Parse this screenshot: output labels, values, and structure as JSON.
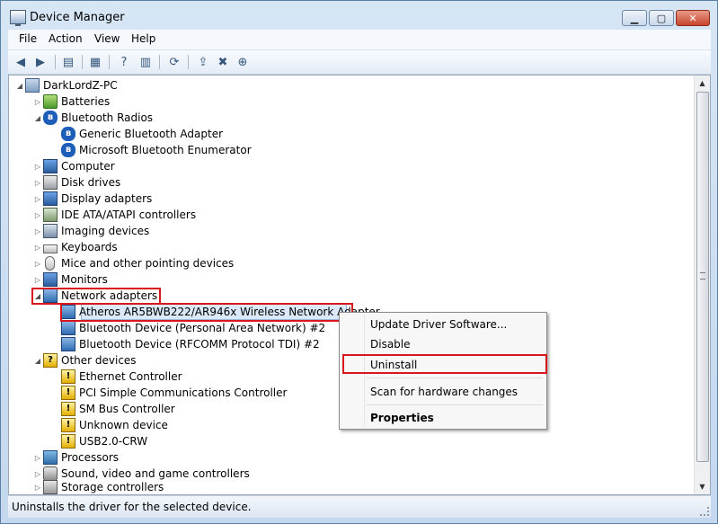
{
  "window": {
    "title": "Device Manager",
    "caption_min": "▁",
    "caption_max": "▢",
    "caption_close": "✕"
  },
  "menu": [
    "File",
    "Action",
    "View",
    "Help"
  ],
  "toolbar": {
    "icons": [
      "back-icon",
      "forward-icon",
      "show-hide-tree-icon",
      "properties-icon",
      "help-icon",
      "show-hidden-icon",
      "update-driver-icon",
      "uninstall-icon",
      "scan-hardware-icon"
    ]
  },
  "tree": {
    "root": "DarkLordZ-PC",
    "items": [
      {
        "label": "Batteries"
      },
      {
        "label": "Bluetooth Radios"
      },
      {
        "label": "Generic Bluetooth Adapter"
      },
      {
        "label": "Microsoft Bluetooth Enumerator"
      },
      {
        "label": "Computer"
      },
      {
        "label": "Disk drives"
      },
      {
        "label": "Display adapters"
      },
      {
        "label": "IDE ATA/ATAPI controllers"
      },
      {
        "label": "Imaging devices"
      },
      {
        "label": "Keyboards"
      },
      {
        "label": "Mice and other pointing devices"
      },
      {
        "label": "Monitors"
      },
      {
        "label": "Network adapters"
      },
      {
        "label": "Atheros AR5BWB222/AR946x Wireless Network Adapter"
      },
      {
        "label": "Bluetooth Device (Personal Area Network) #2"
      },
      {
        "label": "Bluetooth Device (RFCOMM Protocol TDI) #2"
      },
      {
        "label": "Other devices"
      },
      {
        "label": "Ethernet Controller"
      },
      {
        "label": "PCI Simple Communications Controller"
      },
      {
        "label": "SM Bus Controller"
      },
      {
        "label": "Unknown device"
      },
      {
        "label": "USB2.0-CRW"
      },
      {
        "label": "Processors"
      },
      {
        "label": "Sound, video and game controllers"
      },
      {
        "label": "Storage controllers"
      }
    ]
  },
  "context_menu": {
    "items": [
      "Update Driver Software...",
      "Disable",
      "Uninstall",
      "Scan for hardware changes",
      "Properties"
    ]
  },
  "status": {
    "text": "Uninstalls the driver for the selected device."
  },
  "colors": {
    "highlight": "#d9161e",
    "selection": "#dbe8f7"
  }
}
